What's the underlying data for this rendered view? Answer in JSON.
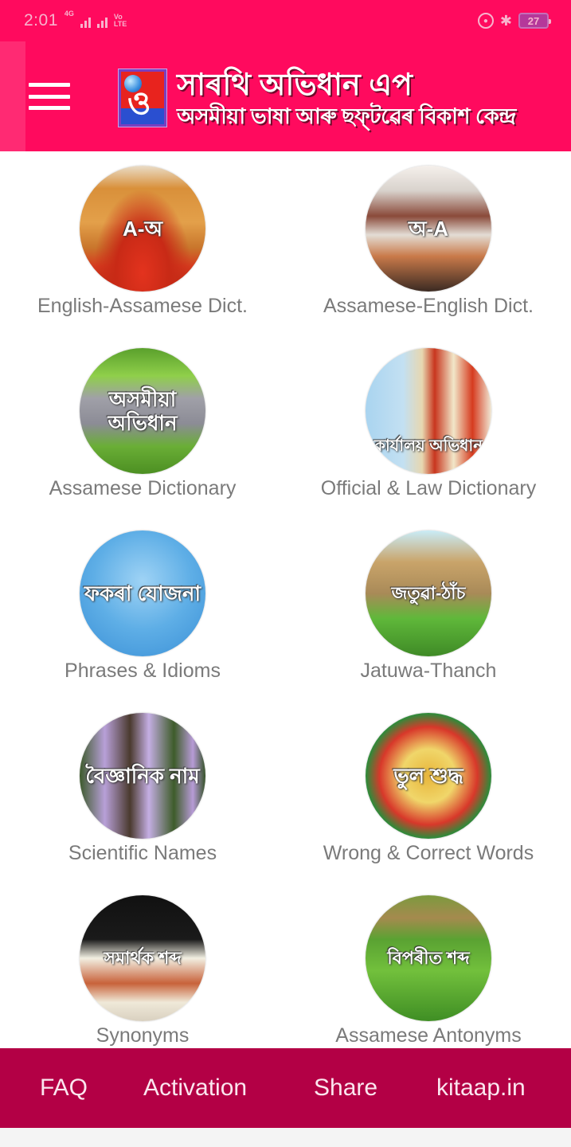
{
  "status_bar": {
    "time": "2:01",
    "network_type": "4G",
    "volte_top": "Vo",
    "volte_bottom": "LTE",
    "icons": [
      "signal-icon",
      "signal-icon",
      "volte-icon",
      "rotation-lock-icon",
      "bluetooth-icon",
      "battery-icon"
    ],
    "battery_level": "27",
    "bluetooth_glyph": "✱",
    "lock_glyph": "🔒"
  },
  "header": {
    "menu_icon": "hamburger-menu-icon",
    "logo_glyph": "ও",
    "title": "সাৰথি অভিধান এপ",
    "subtitle": "অসমীয়া ভাষা আৰু ছফ্‌টৱেৰ বিকাশ কেন্দ্ৰ",
    "brand_color": "#ff0a5e"
  },
  "tiles": [
    {
      "label": "English-Assamese Dict.",
      "thumb_text": "A-অ"
    },
    {
      "label": "Assamese-English Dict.",
      "thumb_text": "অ-A"
    },
    {
      "label": "Assamese Dictionary",
      "thumb_text": "অসমীয়া অভিধান"
    },
    {
      "label": "Official & Law Dictionary",
      "thumb_text": "কাৰ্যালয় অভিধান"
    },
    {
      "label": "Phrases & Idioms",
      "thumb_text": "ফকৰা যোজনা"
    },
    {
      "label": "Jatuwa-Thanch",
      "thumb_text": "জতুৱা-ঠাঁচ"
    },
    {
      "label": "Scientific Names",
      "thumb_text": "বৈজ্ঞানিক নাম"
    },
    {
      "label": "Wrong & Correct Words",
      "thumb_text": "ভুল শুদ্ধ"
    },
    {
      "label": "Synonyms",
      "thumb_text": "সমাৰ্থক শব্দ"
    },
    {
      "label": "Assamese Antonyms",
      "thumb_text": "বিপৰীত শব্দ"
    }
  ],
  "bottom_nav": {
    "items": [
      {
        "label": "FAQ"
      },
      {
        "label": "Activation"
      },
      {
        "label": "Share"
      },
      {
        "label": "kitaap.in"
      }
    ],
    "color": "#b30045"
  }
}
